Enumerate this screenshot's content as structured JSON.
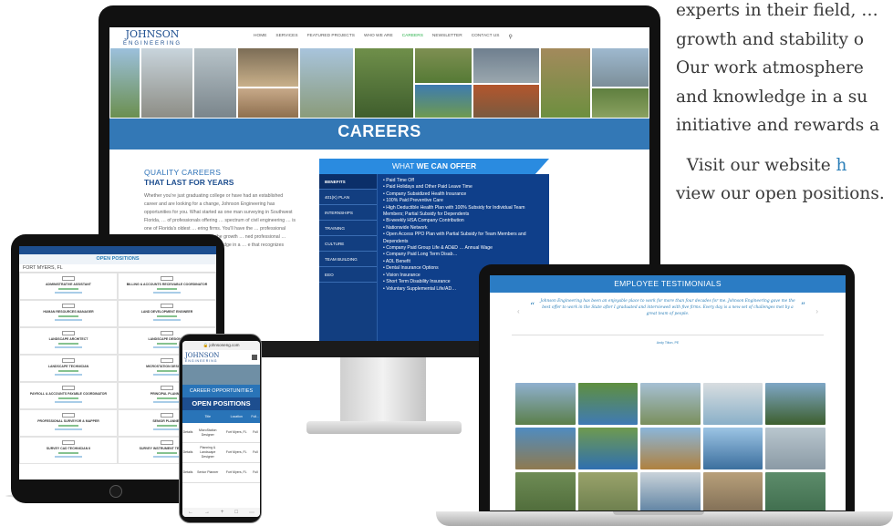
{
  "side_text": {
    "lines": [
      "experts in their field, …",
      "growth and stability o",
      "Our work atmosphere",
      "and knowledge in a su",
      "initiative and rewards a"
    ],
    "visit_prefix": "Visit our website ",
    "visit_link": "h",
    "line_last": "view our open positions."
  },
  "desktop": {
    "logo_top": "JOHNSON",
    "logo_bottom": "ENGINEERING",
    "nav": [
      "HOME",
      "SERVICES",
      "FEATURED PROJECTS",
      "WHO WE ARE",
      "CAREERS",
      "NEWSLETTER",
      "CONTACT US"
    ],
    "active_nav": "CAREERS",
    "hero_title": "CAREERS",
    "quality_line1": "QUALITY CAREERS",
    "quality_line2": "THAT LAST FOR YEARS",
    "body_copy": "Whether you're just graduating college or have had an established career and are looking for a change, Johnson Engineering has opportunities for you. What started as one man surveying in Southwest Florida, … of professionals offering … spectrum of civil engineering … is one of Florida's oldest … ering firms. You'll have the … professional experts in their … ects, and enjoy the growth … ned professional … osphere promotes the full … d knowledge in a … e that recognizes initiative",
    "offer_heading_plain": "WHAT ",
    "offer_heading_bold": "WE CAN OFFER",
    "offer_tabs": [
      "BENEFITS",
      "401(K) PLAN",
      "INTERNSHIPS",
      "TRAINING",
      "CULTURE",
      "TEAM BUILDING",
      "EEO"
    ],
    "offer_items": [
      "Paid Time Off",
      "Paid Holidays and Other Paid Leave Time",
      "Company Subsidized Health Insurance",
      "100% Paid Preventive Care",
      "High Deductible Health Plan with 100% Subsidy for Individual Team Members; Partial Subsidy for Dependents",
      "Bi-weekly HSA Company Contribution",
      "Nationwide Network",
      "Open Access PPO Plan with Partial Subsidy for Team Members and Dependents",
      "Company Paid Group Life & AD&D … Annual Wage",
      "Company Paid Long Term Disab…",
      "ADL Benefit",
      "Dental Insurance Options",
      "Vision Insurance",
      "Short Term Disability Insurance",
      "Voluntary Supplemental Life/AD…"
    ]
  },
  "tablet": {
    "title": "OPEN POSITIONS",
    "location": "FORT MYERS, FL",
    "positions": [
      "ADMINISTRATIVE ASSISTANT",
      "BILLING & ACCOUNTS RECEIVABLE COORDINATOR",
      "HUMAN RESOURCES MANAGER",
      "LAND DEVELOPMENT ENGINEER",
      "LANDSCAPE ARCHITECT",
      "LANDSCAPE DESIGNER",
      "LANDSCAPE TECHNICIAN",
      "MICROSTATION DESIGNER",
      "PAYROLL & ACCOUNTS PAYABLE COORDINATOR",
      "PRINCIPAL PLANNER",
      "PROFESSIONAL SURVEYOR & MAPPER",
      "SENIOR PLANNER",
      "SURVEY CAD TECHNICIAN II",
      "SURVEY INSTRUMENT TECHNICIAN"
    ]
  },
  "phone": {
    "url": "johnsoneng.com",
    "logo_top": "JOHNSON",
    "logo_bottom": "ENGINEERING",
    "hero_band": "CAREER OPPORTUNITIES",
    "heading": "OPEN POSITIONS",
    "columns": [
      "",
      "Title",
      "Location",
      "Full…"
    ],
    "rows": [
      [
        "Details",
        "MicroStation Designer",
        "Fort Myers, FL",
        "Full"
      ],
      [
        "Details",
        "Planning & Landscape Designer",
        "Fort Myers, FL",
        "Full"
      ],
      [
        "Details",
        "Senior Planner",
        "Fort Myers, FL",
        "Full"
      ]
    ],
    "nav_icons": [
      "back-icon",
      "forward-icon",
      "plus-icon",
      "tabs-icon",
      "more-icon"
    ]
  },
  "laptop": {
    "title": "EMPLOYEE TESTIMONIALS",
    "quote": "Johnson Engineering has been an enjoyable place to work for more than four decades for me. Johnson Engineering gave me the best offer to work in the State after I graduated and interviewed with five firms. Every day is a new set of challenges met by a great team of people.",
    "author": "Andy Tilton, PE",
    "gallery_colors": [
      "#5b7f4a",
      "#3f7ab5",
      "#7a8f5c",
      "#8ab0c8",
      "#7fa7c6",
      "#4f8cc0",
      "#6f9a4f",
      "#b0813e",
      "#3c6f9e",
      "#8b9aa5",
      "#6e8c55",
      "#9aa36b",
      "#5a7fa0",
      "#b8a07a",
      "#5d8c6b"
    ]
  },
  "colors": {
    "brand_blue": "#1d4e8f",
    "accent_blue": "#2a8be0",
    "green": "#2bb24c",
    "link_blue": "#2c7fb8"
  }
}
